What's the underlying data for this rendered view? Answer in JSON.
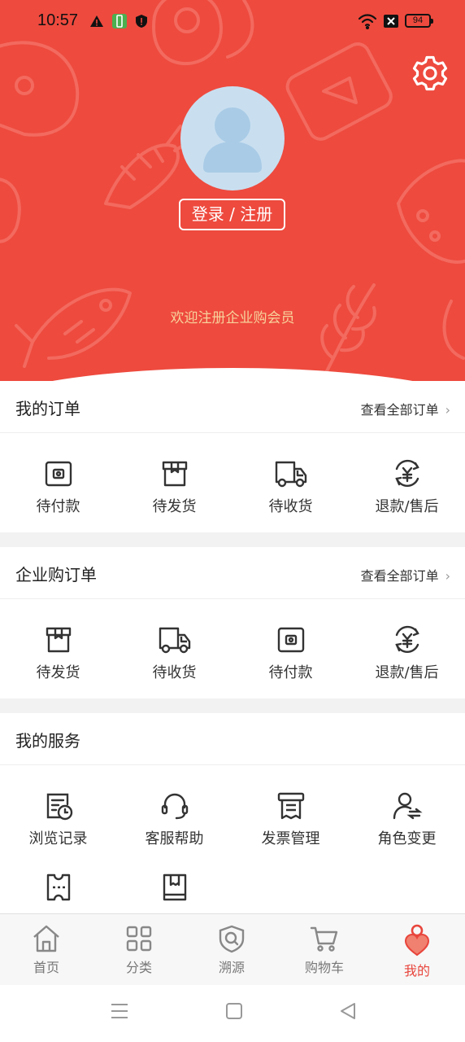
{
  "status_bar": {
    "time": "10:57",
    "battery": "94"
  },
  "profile": {
    "login_label": "登录 / 注册",
    "welcome_text": "欢迎注册企业购会员"
  },
  "orders": {
    "title": "我的订单",
    "view_all": "查看全部订单",
    "items": [
      {
        "label": "待付款",
        "icon": "wallet-icon"
      },
      {
        "label": "待发货",
        "icon": "box-icon"
      },
      {
        "label": "待收货",
        "icon": "truck-icon"
      },
      {
        "label": "退款/售后",
        "icon": "refund-icon"
      }
    ]
  },
  "enterprise_orders": {
    "title": "企业购订单",
    "view_all": "查看全部订单",
    "items": [
      {
        "label": "待发货",
        "icon": "box-icon"
      },
      {
        "label": "待收货",
        "icon": "truck-icon"
      },
      {
        "label": "待付款",
        "icon": "wallet-icon"
      },
      {
        "label": "退款/售后",
        "icon": "refund-icon"
      }
    ]
  },
  "services": {
    "title": "我的服务",
    "items": [
      {
        "label": "浏览记录",
        "icon": "history-icon"
      },
      {
        "label": "客服帮助",
        "icon": "headset-icon"
      },
      {
        "label": "发票管理",
        "icon": "invoice-icon"
      },
      {
        "label": "角色变更",
        "icon": "role-switch-icon"
      },
      {
        "label": "",
        "icon": "ticket-icon"
      },
      {
        "label": "",
        "icon": "book-icon"
      }
    ]
  },
  "tabbar": {
    "items": [
      {
        "label": "首页",
        "icon": "home-icon"
      },
      {
        "label": "分类",
        "icon": "category-icon"
      },
      {
        "label": "溯源",
        "icon": "trace-icon"
      },
      {
        "label": "购物车",
        "icon": "cart-icon"
      },
      {
        "label": "我的",
        "icon": "profile-icon",
        "active": true
      }
    ]
  },
  "colors": {
    "brand_red": "#ee4a3e",
    "welcome_gold": "#f7d29b",
    "active_tab": "#e8453c"
  }
}
